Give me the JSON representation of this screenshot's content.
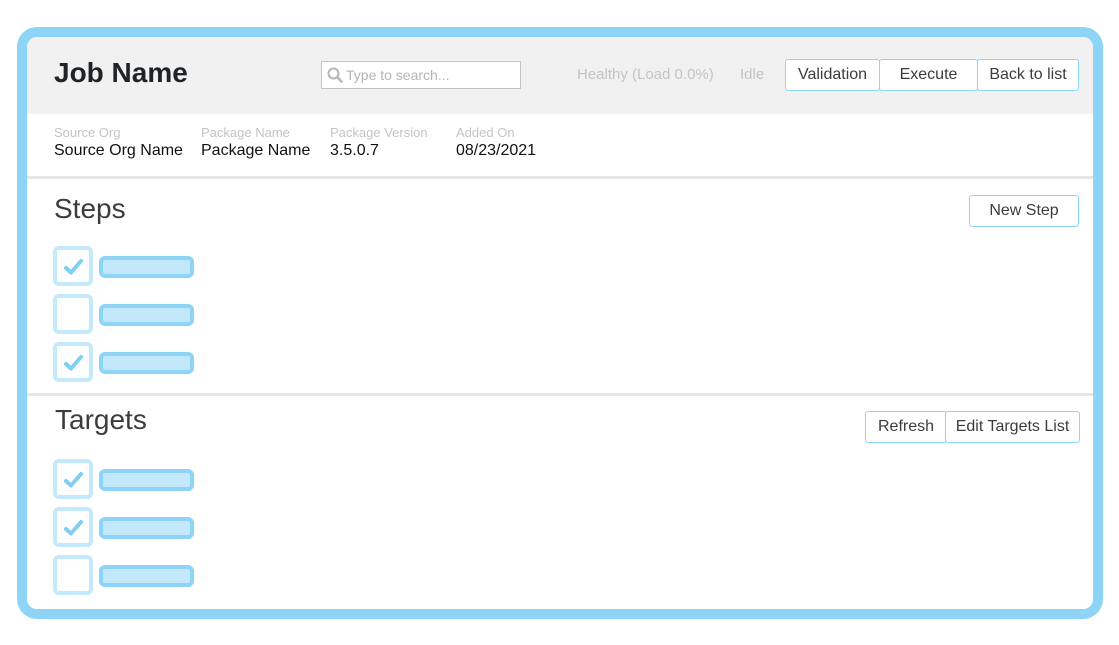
{
  "header": {
    "title": "Job Name",
    "search": {
      "placeholder": "Type to search...",
      "value": ""
    },
    "health_status": "Healthy (Load 0.0%)",
    "run_status": "Idle",
    "buttons": {
      "validation": "Validation",
      "execute": "Execute",
      "back": "Back to list"
    }
  },
  "meta": [
    {
      "label": "Source Org",
      "value": "Source Org Name"
    },
    {
      "label": "Package Name",
      "value": "Package Name"
    },
    {
      "label": "Package Version",
      "value": "3.5.0.7"
    },
    {
      "label": "Added On",
      "value": "08/23/2021"
    }
  ],
  "steps": {
    "title": "Steps",
    "new_button": "New Step",
    "items": [
      {
        "checked": true
      },
      {
        "checked": false
      },
      {
        "checked": true
      }
    ]
  },
  "targets": {
    "title": "Targets",
    "refresh_button": "Refresh",
    "edit_button": "Edit Targets List",
    "items": [
      {
        "checked": true
      },
      {
        "checked": true
      },
      {
        "checked": false
      }
    ]
  },
  "colors": {
    "accent": "#8dd4f6",
    "accent_light": "#c4e8fc",
    "check": "#7fcff2",
    "header_bg": "#f1f1f1"
  }
}
